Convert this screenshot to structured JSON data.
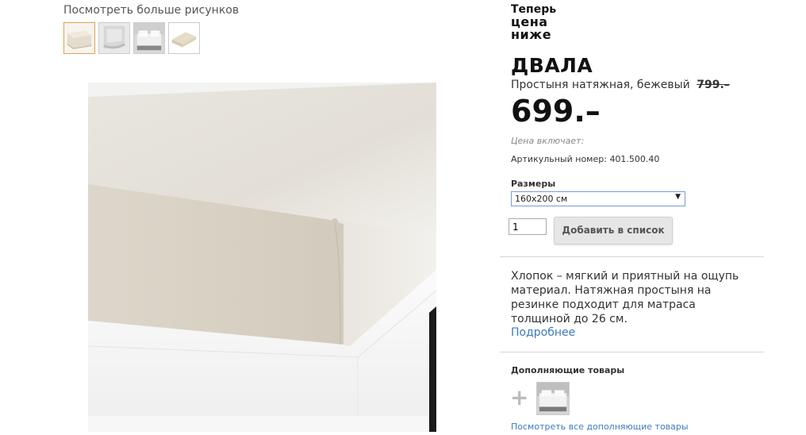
{
  "gallery": {
    "title": "Посмотреть больше рисунков",
    "thumbnails": [
      "sheet-corner-thumb",
      "sheet-elastic-thumb",
      "bed-room-thumb",
      "folded-sheet-thumb"
    ]
  },
  "promo": {
    "line1": "Теперь",
    "line2": "цена",
    "line3": "ниже"
  },
  "product": {
    "name": "ДВАЛА",
    "description": "Простыня натяжная, бежевый",
    "old_price": "799.–",
    "price": "699.–",
    "price_includes": "Цена включает:",
    "article_label": "Артикульный номер:",
    "article_number": "401.500.40"
  },
  "sizes": {
    "label": "Размеры",
    "selected": "160x200 см"
  },
  "purchase": {
    "quantity": "1",
    "add_label": "Добавить в список"
  },
  "info": {
    "text": "Хлопок – мягкий и приятный на ощупь материал. Натяжная простыня на резинке подходит для матраса толщиной до 26 см.",
    "more_link": "Подробнее"
  },
  "related": {
    "title": "Дополняющие товары",
    "link": "Посмотреть все дополняющие товары"
  },
  "colors": {
    "link": "#3b7bc0",
    "select_border": "#7a9cd3",
    "active_thumb_border": "#e0a050"
  }
}
